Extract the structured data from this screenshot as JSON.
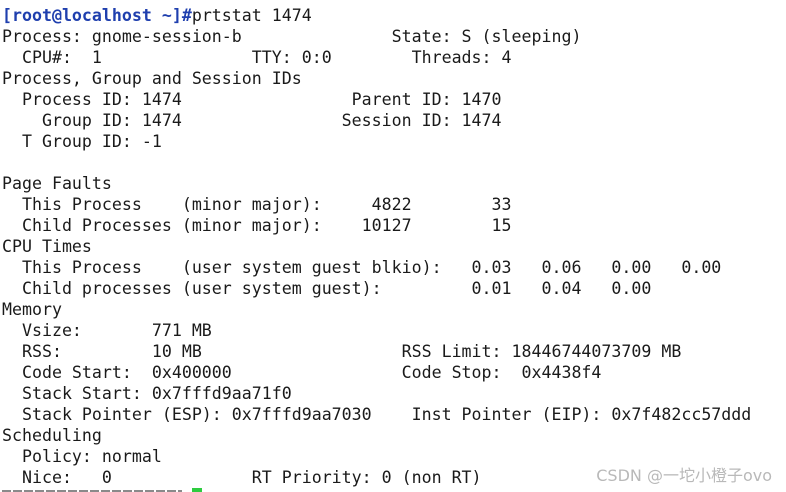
{
  "prompt": {
    "user_host": "[root@localhost ~]#",
    "command": "prtstat 1474"
  },
  "output_lines": [
    "Process: gnome-session-b               State: S (sleeping)",
    "  CPU#:  1               TTY: 0:0        Threads: 4",
    "Process, Group and Session IDs",
    "  Process ID: 1474                 Parent ID: 1470",
    "    Group ID: 1474                Session ID: 1474",
    "  T Group ID: -1",
    "",
    "Page Faults",
    "  This Process    (minor major):     4822        33",
    "  Child Processes (minor major):    10127        15",
    "CPU Times",
    "  This Process    (user system guest blkio):   0.03   0.06   0.00   0.00",
    "  Child processes (user system guest):         0.01   0.04   0.00",
    "Memory",
    "  Vsize:       771 MB",
    "  RSS:         10 MB                    RSS Limit: 18446744073709 MB",
    "  Code Start:  0x400000                 Code Stop:  0x4438f4",
    "  Stack Start: 0x7fffd9aa71f0",
    "  Stack Pointer (ESP): 0x7fffd9aa7030    Inst Pointer (EIP): 0x7f482cc57ddd",
    "Scheduling",
    "  Policy: normal",
    "  Nice:   0              RT Priority: 0 (non RT)"
  ],
  "watermark": "CSDN @一坨小橙子ovo",
  "colors": {
    "background": "#ffffff",
    "text": "#1a1a1a",
    "prompt": "#1f3fae",
    "cursor": "#2ecc40"
  }
}
